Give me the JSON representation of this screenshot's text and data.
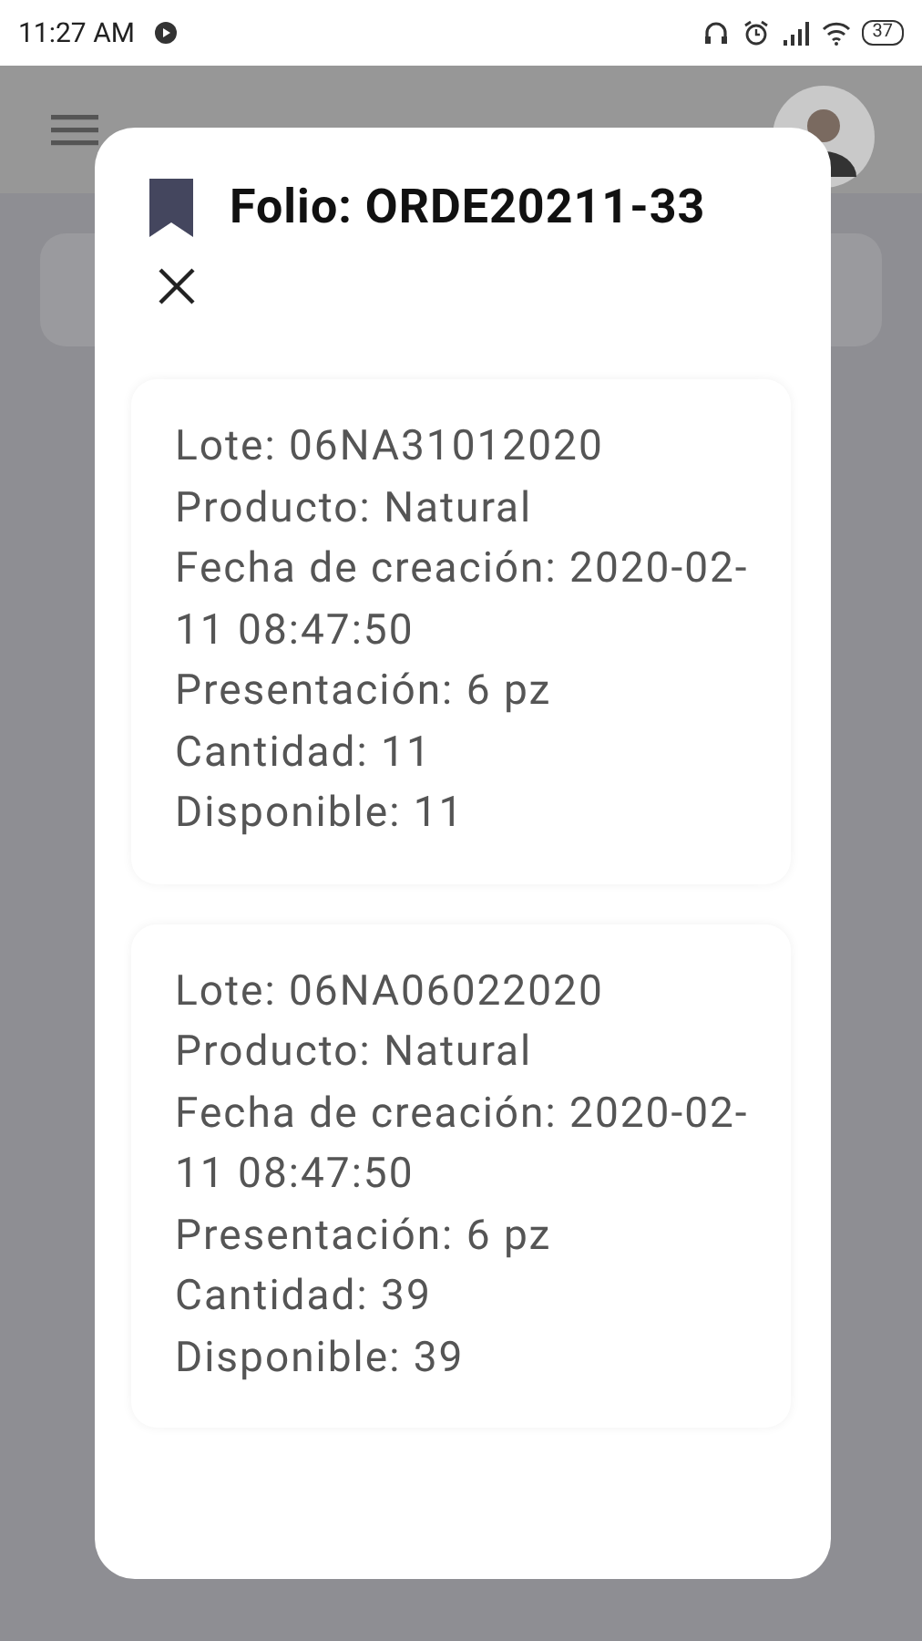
{
  "status_bar": {
    "time": "11:27 AM",
    "battery": "37"
  },
  "dialog": {
    "title": "Folio: ORDE20211-33",
    "lots": [
      {
        "lines": [
          "Lote: 06NA31012020",
          "Producto: Natural",
          "Fecha de creación: 2020-02-11 08:47:50",
          "Presentación: 6 pz",
          "Cantidad: 11",
          "Disponible: 11"
        ]
      },
      {
        "lines": [
          "Lote: 06NA06022020",
          "Producto: Natural",
          "Fecha de creación: 2020-02-11 08:47:50",
          "Presentación: 6 pz",
          "Cantidad: 39",
          "Disponible: 39"
        ]
      }
    ]
  }
}
